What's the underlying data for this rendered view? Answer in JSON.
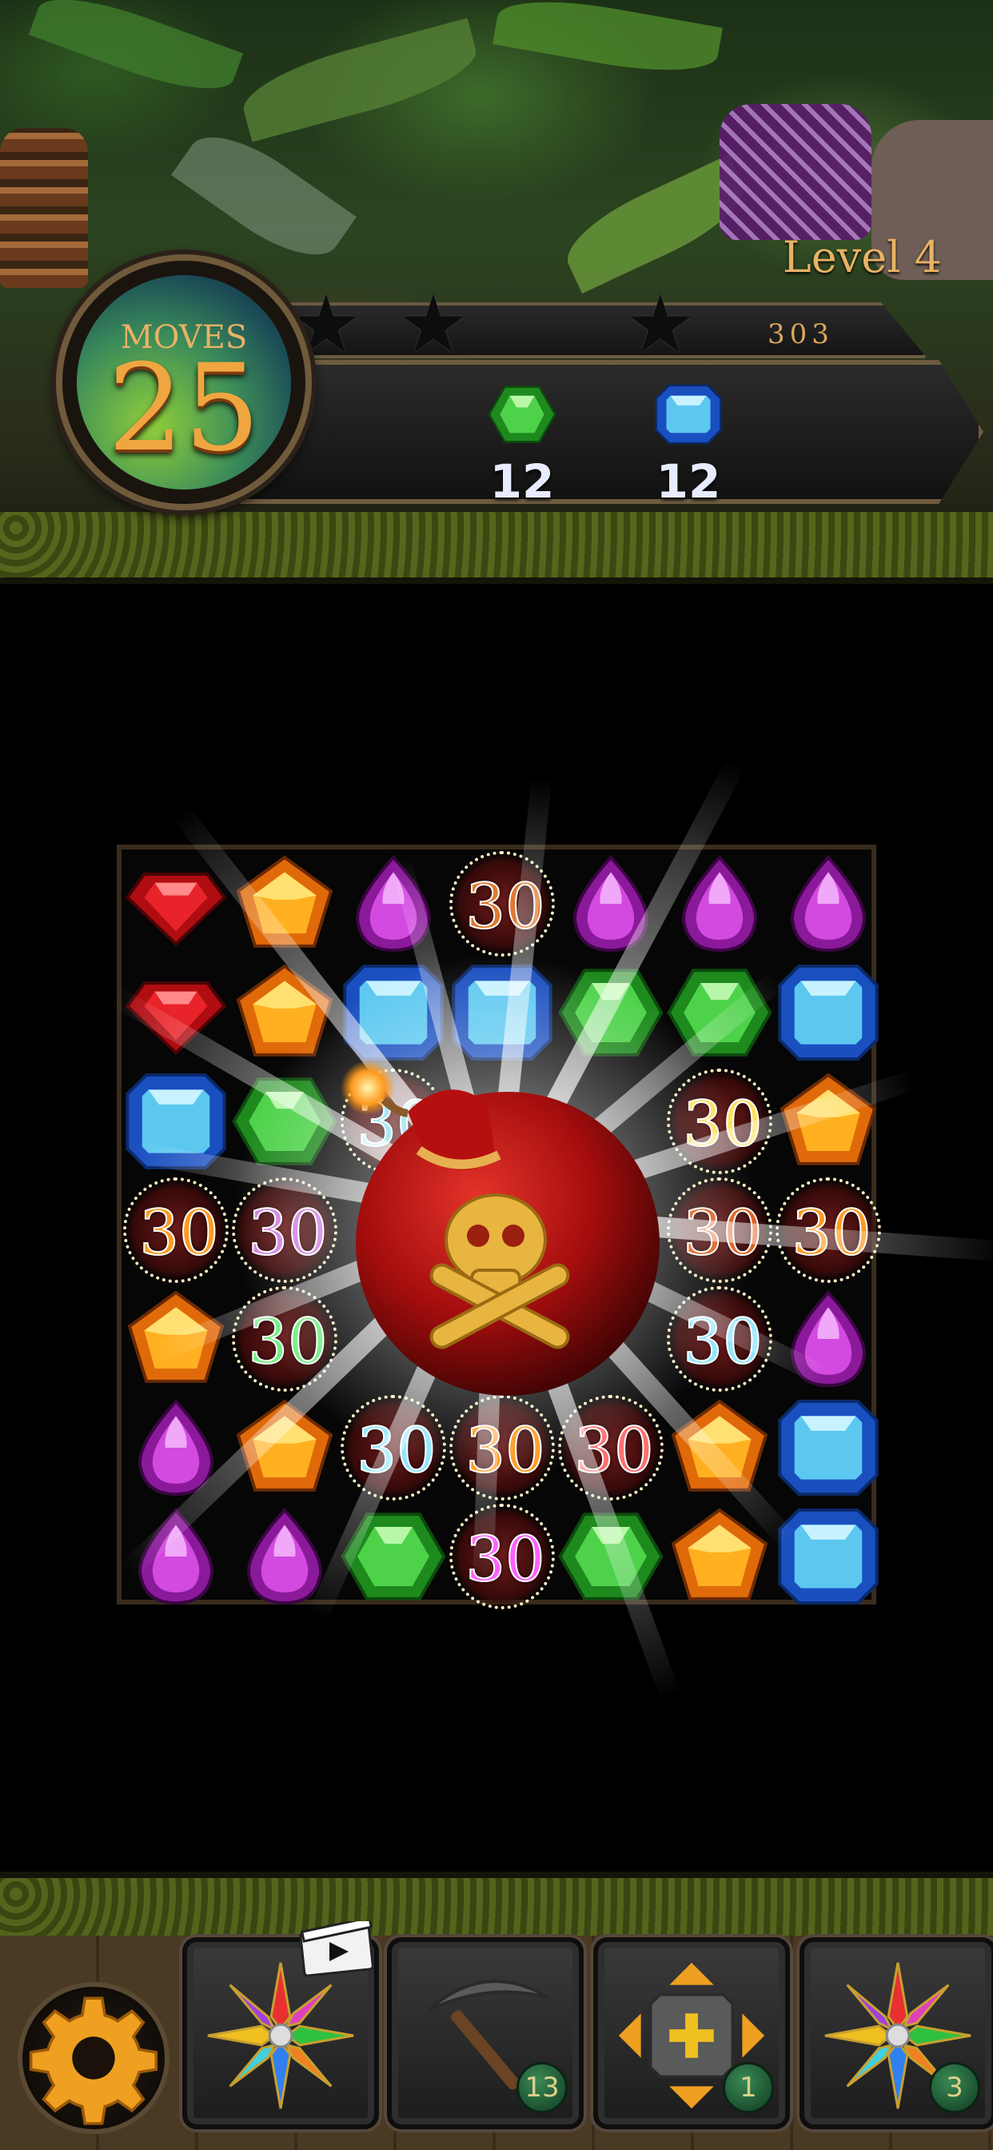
{
  "header": {
    "level_label": "Level 4",
    "moves_label": "MOVES",
    "moves_value": "25",
    "score": "303",
    "stars_earned": 0,
    "stars_total": 3,
    "goals": [
      {
        "gem": "green-gem",
        "count": "12"
      },
      {
        "gem": "blue-gem",
        "count": "12"
      }
    ]
  },
  "board": {
    "columns": 7,
    "rows": 7,
    "grid": [
      [
        "red",
        "orange",
        "purple",
        "pop:30:#e07a30",
        "purple",
        "purple",
        "purple"
      ],
      [
        "red",
        "orange",
        "blue",
        "blue",
        "green",
        "green",
        "blue"
      ],
      [
        "blue",
        "green",
        "pop:30:#7fe0f0",
        "bomb",
        "bomb",
        "pop:30:#ffe060",
        "orange"
      ],
      [
        "pop:30:#ff9a20",
        "pop:30:#d080e0",
        "bomb",
        "bomb",
        "bomb",
        "pop:30:#e06020",
        "pop:30:#ff9a20"
      ],
      [
        "orange",
        "pop:30:#70f080",
        "bomb",
        "bomb",
        "bomb",
        "pop:30:#8fe8ff",
        "purple"
      ],
      [
        "purple",
        "orange",
        "pop:30:#8fe8ff",
        "pop:30:#ff9a20",
        "pop:30:#ff7070",
        "orange",
        "blue"
      ],
      [
        "purple",
        "purple",
        "green",
        "pop:30:#ff60ff",
        "green",
        "orange",
        "blue"
      ]
    ],
    "floating_points": [
      "30",
      "30",
      "30"
    ],
    "special": "skull-bomb"
  },
  "dock": {
    "settings_icon": "gear-icon",
    "boosters": [
      {
        "name": "rainbow-star",
        "count": null,
        "video": true
      },
      {
        "name": "pickaxe",
        "count": "13"
      },
      {
        "name": "swap-arrows",
        "count": "1"
      },
      {
        "name": "rainbow-star",
        "count": "3"
      }
    ]
  },
  "colors": {
    "accent": "#e8b265",
    "moves_value": "#f0a640"
  }
}
